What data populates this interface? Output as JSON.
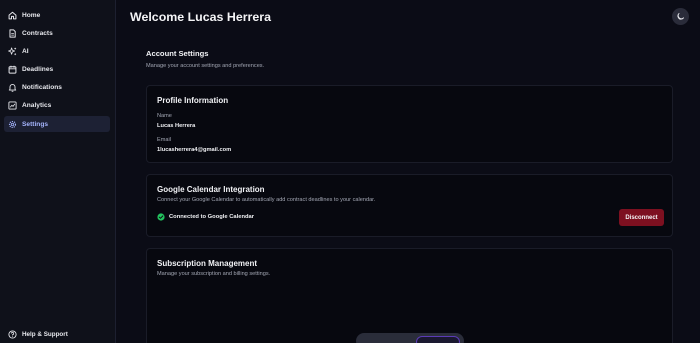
{
  "sidebar": {
    "items": [
      {
        "label": "Home",
        "icon": "home-icon",
        "active": false
      },
      {
        "label": "Contracts",
        "icon": "document-icon",
        "active": false
      },
      {
        "label": "AI",
        "icon": "sparkles-icon",
        "active": false
      },
      {
        "label": "Deadlines",
        "icon": "calendar-icon",
        "active": false
      },
      {
        "label": "Notifications",
        "icon": "bell-icon",
        "active": false
      },
      {
        "label": "Analytics",
        "icon": "chart-icon",
        "active": false
      },
      {
        "label": "Settings",
        "icon": "gear-icon",
        "active": true
      }
    ],
    "help": {
      "label": "Help & Support",
      "icon": "help-icon"
    }
  },
  "header": {
    "title": "Welcome Lucas Herrera",
    "theme_icon": "moon-icon"
  },
  "account": {
    "title": "Account Settings",
    "subtitle": "Manage your account settings and preferences."
  },
  "profile": {
    "title": "Profile Information",
    "name_label": "Name",
    "name_value": "Lucas Herrera",
    "email_label": "Email",
    "email_value": "1lucasherrera4@gmail.com"
  },
  "calendar": {
    "title": "Google Calendar Integration",
    "description": "Connect your Google Calendar to automatically add contract deadlines to your calendar.",
    "status": "Connected to Google Calendar",
    "disconnect_label": "Disconnect"
  },
  "subscription": {
    "title": "Subscription Management",
    "description": "Manage your subscription and billing settings."
  },
  "colors": {
    "accent": "#a5b4fc",
    "danger": "#7d1020",
    "success": "#22c55e"
  }
}
